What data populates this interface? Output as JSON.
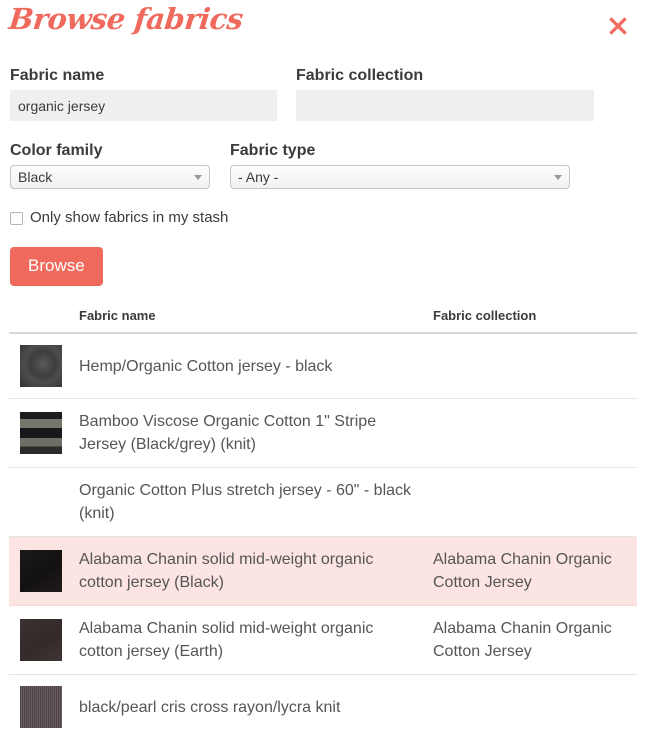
{
  "dialog": {
    "title": "Browse fabrics",
    "close_label": "×",
    "accent_color": "#ef6a5c",
    "highlight_row_color": "#fbe4e2"
  },
  "form": {
    "fabric_name": {
      "label": "Fabric name",
      "value": "organic jersey",
      "placeholder": ""
    },
    "fabric_collection": {
      "label": "Fabric collection",
      "value": "",
      "placeholder": ""
    },
    "color_family": {
      "label": "Color family",
      "value": "Black"
    },
    "fabric_type": {
      "label": "Fabric type",
      "value": "- Any -"
    },
    "stash_checkbox": {
      "label": "Only show fabrics in my stash",
      "checked": false
    },
    "submit_label": "Browse"
  },
  "results": {
    "columns": [
      "",
      "Fabric name",
      "Fabric collection"
    ],
    "rows": [
      {
        "name": "Hemp/Organic Cotton jersey - black",
        "collection": "",
        "has_thumb": true,
        "thumb_style": "swirl-dark-grey",
        "highlight": false
      },
      {
        "name": "Bamboo Viscose Organic Cotton 1\" Stripe Jersey (Black/grey) (knit)",
        "collection": "",
        "has_thumb": true,
        "thumb_style": "stripe-black-grey",
        "highlight": false
      },
      {
        "name": "Organic Cotton Plus stretch jersey - 60\" - black (knit)",
        "collection": "",
        "has_thumb": false,
        "thumb_style": "",
        "highlight": false
      },
      {
        "name": "Alabama Chanin solid mid-weight organic cotton jersey (Black)",
        "collection": "Alabama Chanin Organic Cotton Jersey",
        "has_thumb": true,
        "thumb_style": "solid-black",
        "highlight": true
      },
      {
        "name": "Alabama Chanin solid mid-weight organic cotton jersey (Earth)",
        "collection": "Alabama Chanin Organic Cotton Jersey",
        "has_thumb": true,
        "thumb_style": "solid-earth",
        "highlight": false
      },
      {
        "name": "black/pearl cris cross rayon/lycra knit",
        "collection": "",
        "has_thumb": true,
        "thumb_style": "criss-cross-mauve",
        "highlight": false
      }
    ]
  }
}
